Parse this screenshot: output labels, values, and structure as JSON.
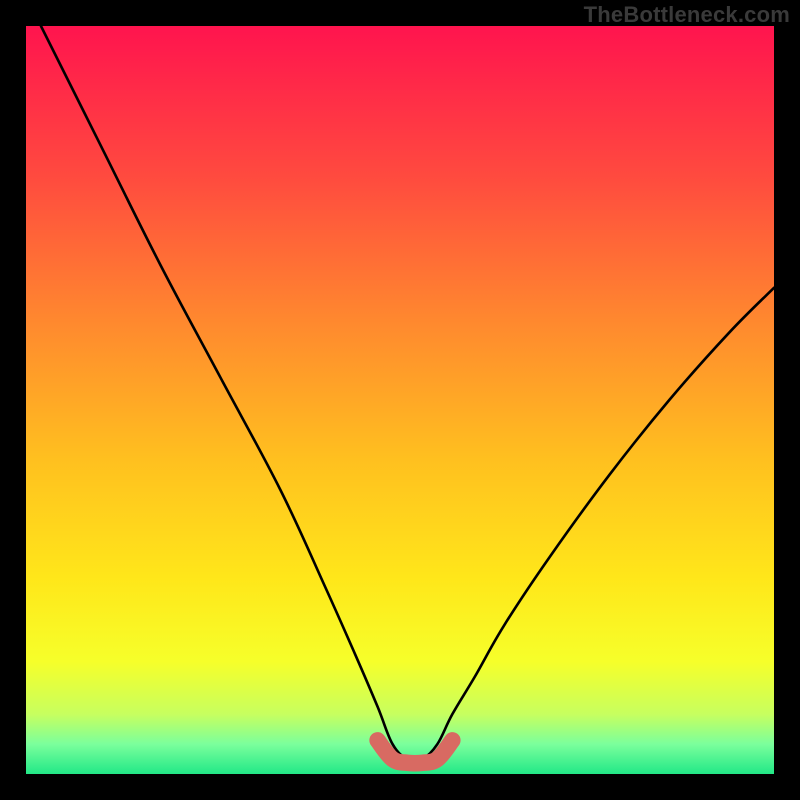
{
  "watermark": "TheBottleneck.com",
  "chart_data": {
    "type": "line",
    "title": "",
    "xlabel": "",
    "ylabel": "",
    "xlim": [
      0,
      100
    ],
    "ylim": [
      0,
      100
    ],
    "grid": false,
    "legend": false,
    "series": [
      {
        "name": "bottleneck_curve",
        "color": "#000000",
        "x": [
          2,
          10,
          18,
          26,
          34,
          40,
          44,
          47,
          49,
          51,
          53,
          55,
          57,
          60,
          64,
          70,
          78,
          86,
          94,
          100
        ],
        "values": [
          100,
          84,
          68,
          53,
          38,
          25,
          16,
          9,
          4,
          2,
          2,
          4,
          8,
          13,
          20,
          29,
          40,
          50,
          59,
          65
        ]
      },
      {
        "name": "optimal_band",
        "color": "#d86a62",
        "x": [
          47,
          49,
          51,
          53,
          55,
          57
        ],
        "values": [
          4.5,
          2,
          1.5,
          1.5,
          2,
          4.5
        ]
      }
    ],
    "background": {
      "type": "vertical_gradient",
      "stops": [
        {
          "offset": 0.0,
          "color": "#ff144e"
        },
        {
          "offset": 0.2,
          "color": "#ff4a3f"
        },
        {
          "offset": 0.4,
          "color": "#ff8a2e"
        },
        {
          "offset": 0.58,
          "color": "#ffc01f"
        },
        {
          "offset": 0.74,
          "color": "#ffe71a"
        },
        {
          "offset": 0.85,
          "color": "#f6ff2a"
        },
        {
          "offset": 0.92,
          "color": "#c7ff5f"
        },
        {
          "offset": 0.96,
          "color": "#7bff9c"
        },
        {
          "offset": 1.0,
          "color": "#22e887"
        }
      ]
    }
  }
}
